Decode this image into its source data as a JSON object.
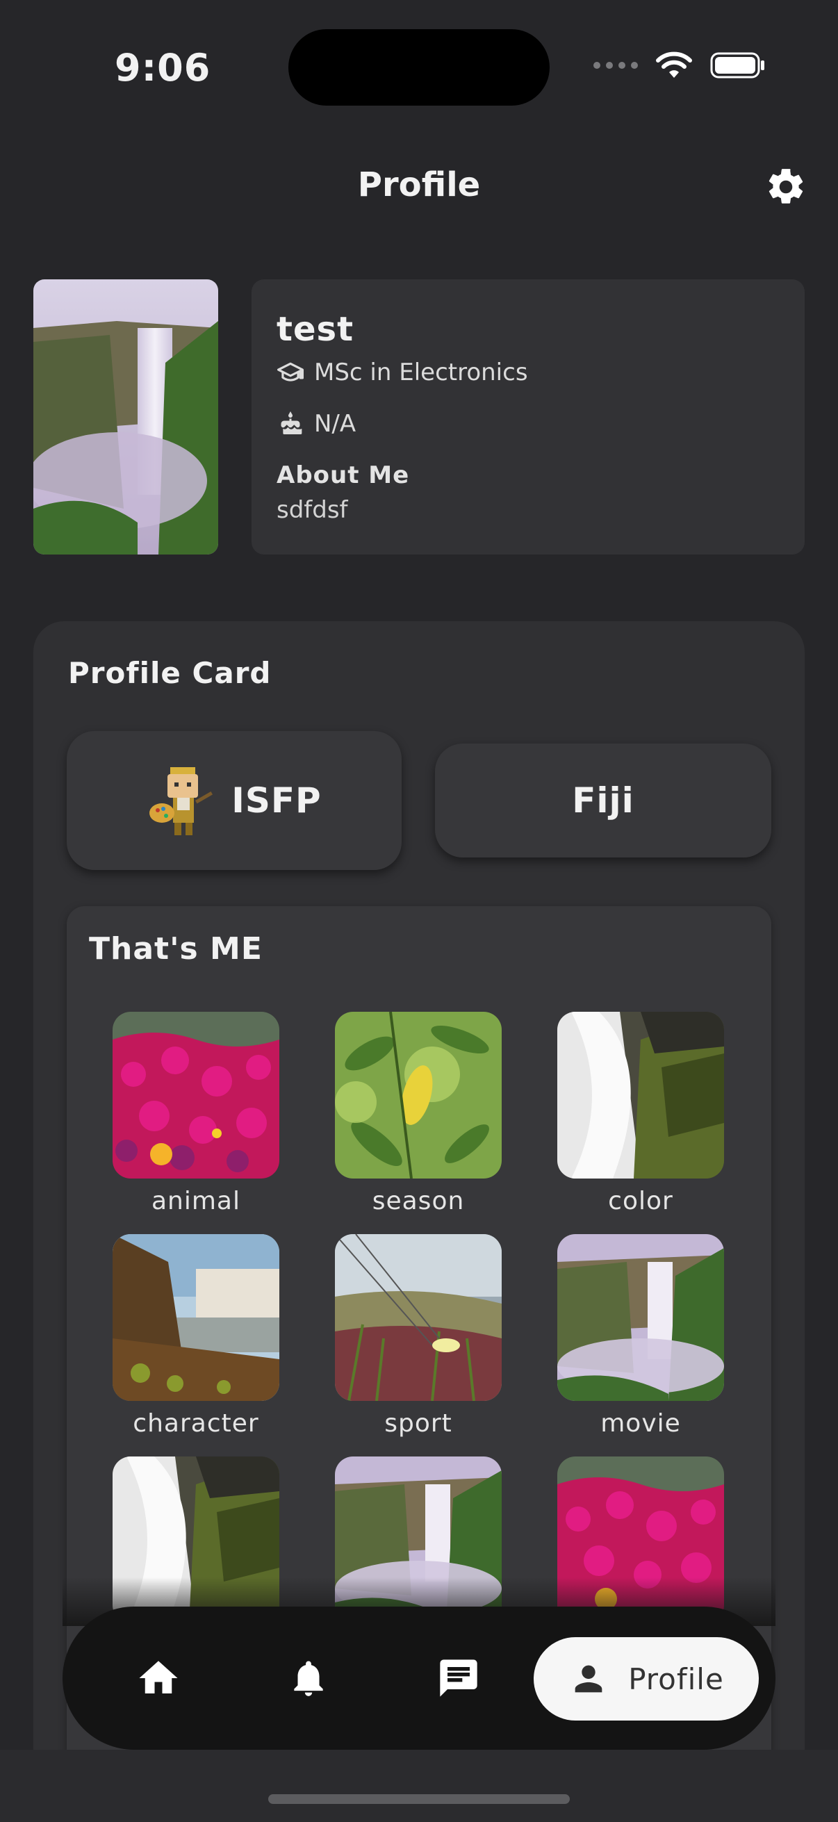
{
  "status_bar": {
    "time": "9:06"
  },
  "header": {
    "title": "Profile",
    "settings_icon": "gear-icon"
  },
  "profile": {
    "name": "test",
    "education": "MSc in Electronics",
    "birthday": "N/A",
    "about_label": "About Me",
    "about_text": "sdfdsf"
  },
  "profile_card": {
    "title": "Profile Card",
    "mbti": "ISFP",
    "country": "Fiji",
    "thats_me": {
      "title": "That's ME",
      "tiles": [
        {
          "label": "animal",
          "image": "flowers"
        },
        {
          "label": "season",
          "image": "leaves"
        },
        {
          "label": "color",
          "image": "waterfall-rocks"
        },
        {
          "label": "character",
          "image": "waterfall-valley"
        },
        {
          "label": "sport",
          "image": "dune-flower"
        },
        {
          "label": "movie",
          "image": "waterfall-mist"
        },
        {
          "label": "",
          "image": "waterfall-rocks"
        },
        {
          "label": "",
          "image": "waterfall-mist"
        },
        {
          "label": "",
          "image": "flowers"
        }
      ]
    }
  },
  "bottom_nav": {
    "items": [
      {
        "name": "home",
        "icon": "home-icon"
      },
      {
        "name": "notifications",
        "icon": "bell-icon"
      },
      {
        "name": "messages",
        "icon": "chat-icon"
      }
    ],
    "active_label": "Profile"
  },
  "colors": {
    "background": "#262629",
    "card": "#323235",
    "nav": "#141414",
    "accent_pill": "#f6f6f6"
  }
}
